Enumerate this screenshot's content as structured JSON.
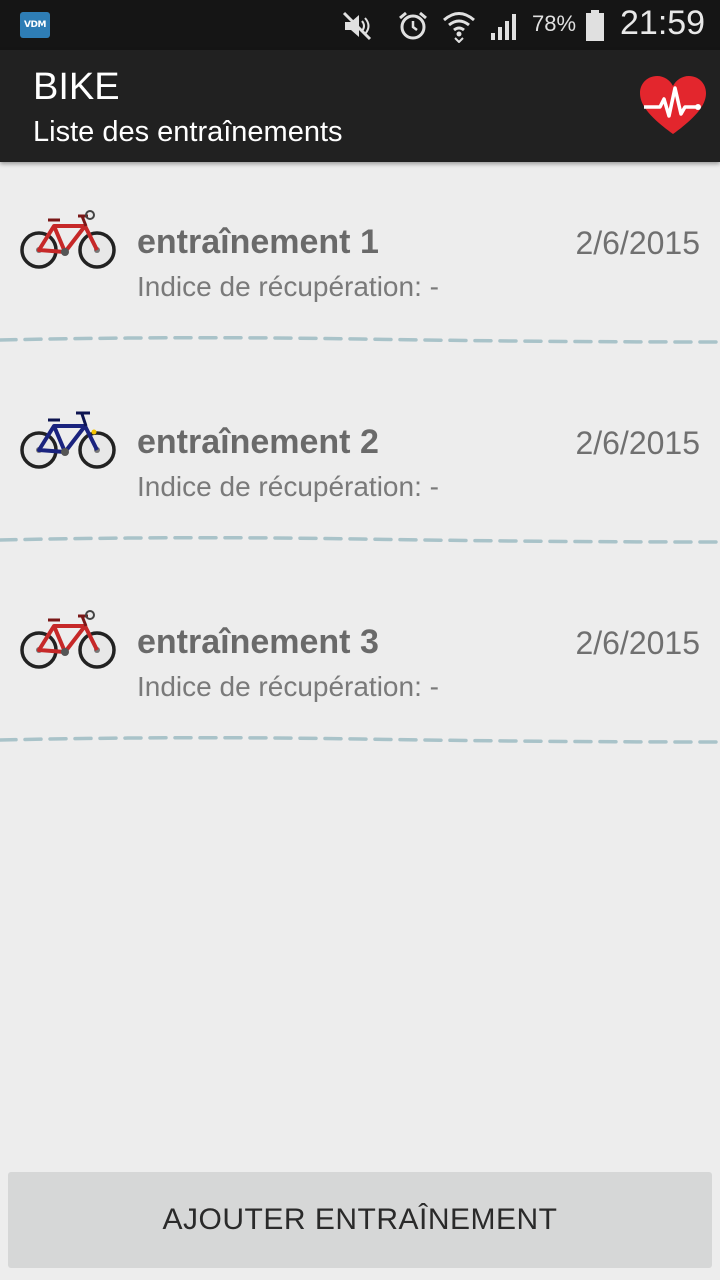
{
  "status_bar": {
    "app_badge": "VDM",
    "battery": "78%",
    "time": "21:59",
    "icons": [
      "mute-icon",
      "alarm-icon",
      "wifi-icon",
      "signal-icon",
      "battery-icon"
    ]
  },
  "action_bar": {
    "title": "BIKE",
    "subtitle": "Liste des entraînements",
    "action_icon": "heart-rate-icon",
    "accent_color": "#e3262d"
  },
  "trainings": [
    {
      "title": "entraînement 1",
      "subtitle": "Indice de récupération: -",
      "date": "2/6/2015",
      "bike_color": "#c62828"
    },
    {
      "title": "entraînement 2",
      "subtitle": "Indice de récupération: -",
      "date": "2/6/2015",
      "bike_color": "#1a237e"
    },
    {
      "title": "entraînement 3",
      "subtitle": "Indice de récupération: -",
      "date": "2/6/2015",
      "bike_color": "#c62828"
    }
  ],
  "footer": {
    "add_button_label": "AJOUTER ENTRAÎNEMENT"
  }
}
